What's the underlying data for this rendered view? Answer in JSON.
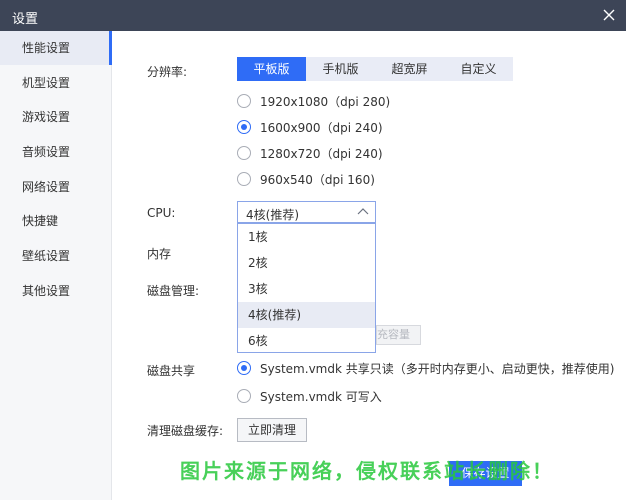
{
  "window": {
    "title": "设置"
  },
  "sidebar": {
    "items": [
      {
        "label": "性能设置",
        "active": true
      },
      {
        "label": "机型设置",
        "active": false
      },
      {
        "label": "游戏设置",
        "active": false
      },
      {
        "label": "音频设置",
        "active": false
      },
      {
        "label": "网络设置",
        "active": false
      },
      {
        "label": "快捷键",
        "active": false
      },
      {
        "label": "壁纸设置",
        "active": false
      },
      {
        "label": "其他设置",
        "active": false
      }
    ]
  },
  "resolution": {
    "label": "分辨率:",
    "tabs": [
      {
        "label": "平板版",
        "active": true
      },
      {
        "label": "手机版",
        "active": false
      },
      {
        "label": "超宽屏",
        "active": false
      },
      {
        "label": "自定义",
        "active": false
      }
    ],
    "options": [
      {
        "label": "1920x1080（dpi 280)",
        "selected": false
      },
      {
        "label": "1600x900（dpi 240)",
        "selected": true
      },
      {
        "label": "1280x720（dpi 240)",
        "selected": false
      },
      {
        "label": "960x540（dpi 160)",
        "selected": false
      }
    ]
  },
  "cpu": {
    "label": "CPU:",
    "selected": "4核(推荐)",
    "options": [
      "1核",
      "2核",
      "3核",
      "4核(推荐)",
      "6核"
    ],
    "highlighted_index": 3
  },
  "memory": {
    "label": "内存"
  },
  "disk": {
    "label": "磁盘管理:",
    "expand_button": "充容量"
  },
  "disk_share": {
    "label": "磁盘共享",
    "options": [
      {
        "label": "System.vmdk 共享只读（多开时内存更小、启动更快，推荐使用)",
        "selected": true
      },
      {
        "label": "System.vmdk 可写入",
        "selected": false
      }
    ]
  },
  "clear_cache": {
    "label": "清理磁盘缓存:",
    "button": "立即清理"
  },
  "footer": {
    "save_button": "保存设置"
  },
  "watermark": "图片来源于网络，侵权联系站长删除！",
  "colors": {
    "accent": "#2f6cf6",
    "titlebar": "#3d4557",
    "sidebar_bg": "#f6f7f9",
    "tab_bg": "#e9ecf6"
  }
}
